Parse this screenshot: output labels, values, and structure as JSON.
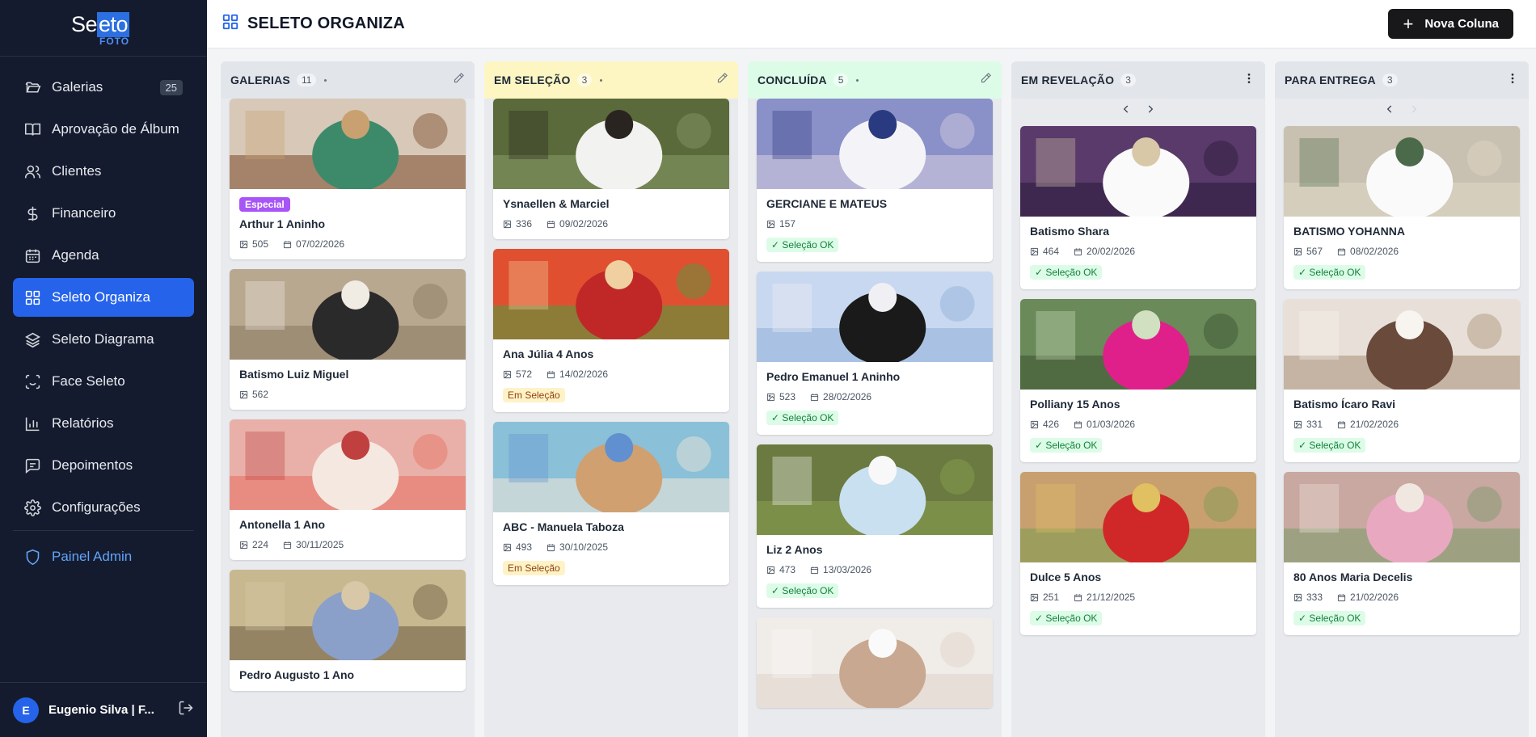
{
  "logo": {
    "part1": "Sel",
    "part2": "eto",
    "sub": "FOTO"
  },
  "sidebar": {
    "items": [
      {
        "label": "Galerias",
        "badge": "25"
      },
      {
        "label": "Aprovação de Álbum"
      },
      {
        "label": "Clientes"
      },
      {
        "label": "Financeiro"
      },
      {
        "label": "Agenda"
      },
      {
        "label": "Seleto Organiza"
      },
      {
        "label": "Seleto Diagrama"
      },
      {
        "label": "Face Seleto"
      },
      {
        "label": "Relatórios"
      },
      {
        "label": "Depoimentos"
      },
      {
        "label": "Configurações"
      }
    ],
    "admin_label": "Painel Admin",
    "user": {
      "initial": "E",
      "name": "Eugenio Silva | F..."
    }
  },
  "header": {
    "title": "SELETO ORGANIZA",
    "new_column_label": "Nova Coluna"
  },
  "colors": {
    "accent": "#2563eb",
    "sidebar_bg": "#151b2e",
    "especial": "#a855f7",
    "ok": "#15803d",
    "em_selecao": "#92400e"
  },
  "columns": [
    {
      "title": "GALERIAS",
      "count": "11",
      "header_color": "#e2e5ea",
      "action_icon": "pencil-icon",
      "cards": [
        {
          "name": "Arthur 1 Aninho",
          "photos": "505",
          "date": "07/02/2026",
          "label": "Especial",
          "status": ""
        },
        {
          "name": "Batismo Luiz Miguel",
          "photos": "562",
          "date": "",
          "status": ""
        },
        {
          "name": "Antonella 1 Ano",
          "photos": "224",
          "date": "30/11/2025",
          "status": ""
        },
        {
          "name": "Pedro Augusto 1 Ano",
          "photos": "",
          "date": "",
          "status": ""
        }
      ]
    },
    {
      "title": "EM SELEÇÃO",
      "count": "3",
      "header_color": "#fdf6c3",
      "action_icon": "pencil-icon",
      "cards": [
        {
          "name": "Ysnaellen & Marciel",
          "photos": "336",
          "date": "09/02/2026",
          "status": ""
        },
        {
          "name": "Ana Júlia 4 Anos",
          "photos": "572",
          "date": "14/02/2026",
          "status": "Em Seleção"
        },
        {
          "name": "ABC - Manuela Taboza",
          "photos": "493",
          "date": "30/10/2025",
          "status": "Em Seleção"
        }
      ]
    },
    {
      "title": "CONCLUÍDA",
      "count": "5",
      "header_color": "#dcfce7",
      "action_icon": "pencil-icon",
      "cards": [
        {
          "name": "GERCIANE E MATEUS",
          "photos": "157",
          "date": "",
          "status": "Seleção OK"
        },
        {
          "name": "Pedro Emanuel 1 Aninho",
          "photos": "523",
          "date": "28/02/2026",
          "status": "Seleção OK"
        },
        {
          "name": "Liz 2 Anos",
          "photos": "473",
          "date": "13/03/2026",
          "status": "Seleção OK"
        },
        {
          "name": "",
          "photos": "",
          "date": "",
          "status": ""
        }
      ]
    },
    {
      "title": "EM REVELAÇÃO",
      "count": "3",
      "header_color": "#e2e5ea",
      "action_icon": "more-vertical-icon",
      "cards": [
        {
          "name": "Batismo Shara",
          "photos": "464",
          "date": "20/02/2026",
          "status": "Seleção OK"
        },
        {
          "name": "Polliany 15 Anos",
          "photos": "426",
          "date": "01/03/2026",
          "status": "Seleção OK"
        },
        {
          "name": "Dulce 5 Anos",
          "photos": "251",
          "date": "21/12/2025",
          "status": "Seleção OK"
        }
      ]
    },
    {
      "title": "PARA ENTREGA",
      "count": "3",
      "header_color": "#e2e5ea",
      "action_icon": "more-vertical-icon",
      "cards": [
        {
          "name": "BATISMO YOHANNA",
          "photos": "567",
          "date": "08/02/2026",
          "status": "Seleção OK"
        },
        {
          "name": "Batismo Ícaro Ravi",
          "photos": "331",
          "date": "21/02/2026",
          "status": "Seleção OK"
        },
        {
          "name": "80 Anos Maria Decelis",
          "photos": "333",
          "date": "21/02/2026",
          "status": "Seleção OK"
        }
      ]
    }
  ]
}
